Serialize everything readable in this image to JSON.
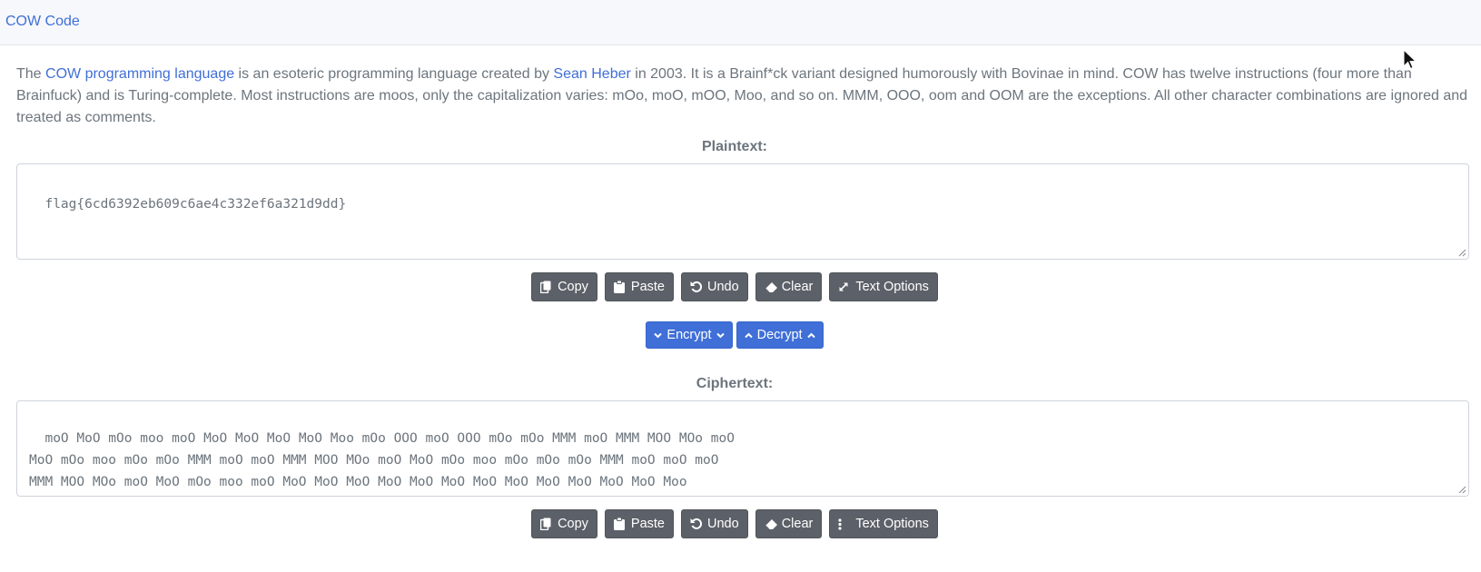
{
  "header": {
    "title": "COW Code"
  },
  "description": {
    "part1": "The ",
    "link1": "COW programming language",
    "part2": " is an esoteric programming language created by ",
    "link2": "Sean Heber",
    "part3": " in 2003. It is a Brainf*ck variant designed humorously with Bovinae in mind. COW has twelve instructions (four more than Brainfuck) and is Turing-complete. Most instructions are moos, only the capitalization varies: mOo, moO, mOO, Moo, and so on. MMM, OOO, oom and OOM are the exceptions. All other character combinations are ignored and treated as comments."
  },
  "plaintext": {
    "label": "Plaintext:",
    "value": "flag{6cd6392eb609c6ae4c332ef6a321d9dd}"
  },
  "plain_buttons": {
    "copy": "Copy",
    "paste": "Paste",
    "undo": "Undo",
    "clear": "Clear",
    "options": "Text Options"
  },
  "actions": {
    "encrypt": "Encrypt",
    "decrypt": "Decrypt"
  },
  "ciphertext": {
    "label": "Ciphertext:",
    "value": "moO MoO mOo moo moO MoO MoO MoO MoO Moo mOo OOO moO OOO mOo mOo MMM moO MMM MOO MOo moO\nMoO mOo moo mOo mOo MMM moO moO MMM MOO MOo moO MoO mOo moo mOo mOo mOo MMM moO moO moO\nMMM MOO MOo moO MoO mOo moo moO MoO MoO MoO MoO MoO MoO MoO MoO MoO MoO MoO MoO Moo\nmOo"
  },
  "cipher_buttons": {
    "copy": "Copy",
    "paste": "Paste",
    "undo": "Undo",
    "clear": "Clear",
    "options": "Text Options"
  },
  "colors": {
    "accent": "#3f6fd7",
    "button_dark": "#5c6068",
    "text_muted": "#6c757d"
  }
}
